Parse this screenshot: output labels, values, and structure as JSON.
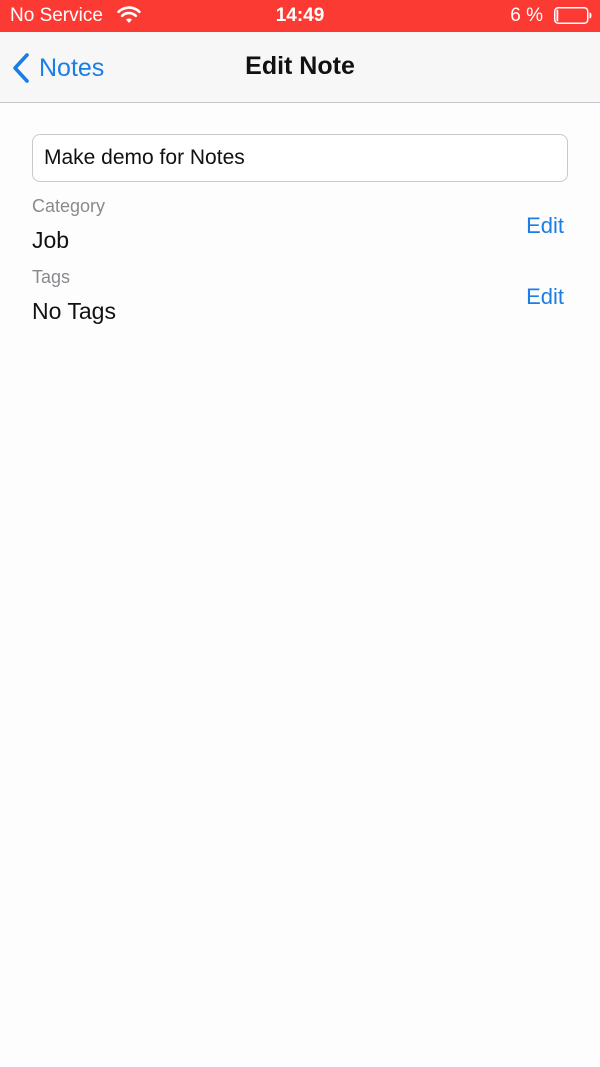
{
  "status_bar": {
    "carrier": "No Service",
    "time": "14:49",
    "battery_percent": "6 %",
    "battery_level": 0.06,
    "wifi_icon": "wifi-icon",
    "battery_icon": "battery-icon",
    "background_color": "#fb3a34"
  },
  "nav": {
    "back_label": "Notes",
    "back_icon": "chevron-left-icon",
    "title": "Edit Note"
  },
  "form": {
    "note_title_value": "Make demo for Notes",
    "category": {
      "label": "Category",
      "value": "Job",
      "edit_label": "Edit"
    },
    "tags": {
      "label": "Tags",
      "value": "No Tags",
      "edit_label": "Edit"
    }
  },
  "colors": {
    "accent": "#1b7ee5",
    "status_bar": "#fb3a34",
    "label": "#8a8a8e"
  }
}
